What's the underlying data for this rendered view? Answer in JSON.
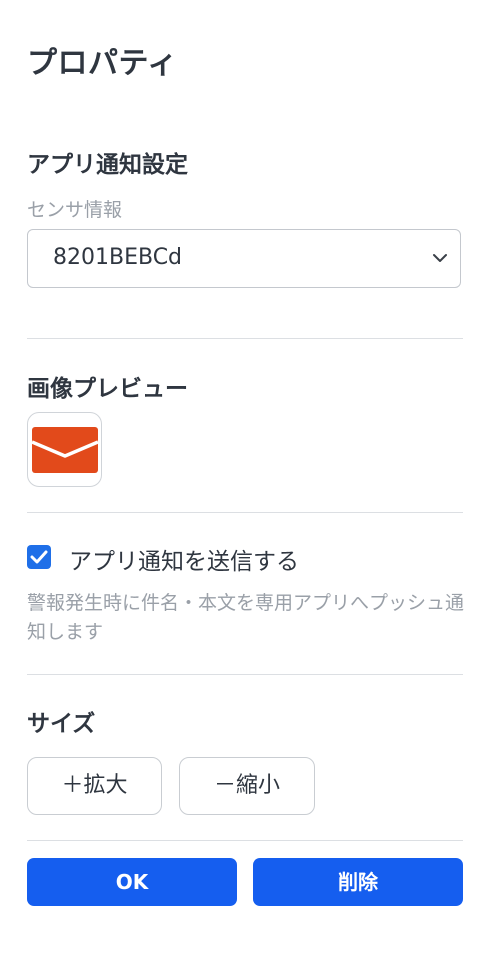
{
  "panel": {
    "title": "プロパティ"
  },
  "notification": {
    "heading": "アプリ通知設定",
    "sensor_label": "センサ情報",
    "sensor_value": "8201BEBCd"
  },
  "preview": {
    "heading": "画像プレビュー",
    "icon": "mail-envelope-icon",
    "icon_color": "#e24a1b"
  },
  "send": {
    "checked": true,
    "label": "アプリ通知を送信する",
    "help_text": "警報発生時に件名・本文を専用アプリへプッシュ通知します"
  },
  "size": {
    "heading": "サイズ",
    "enlarge_label": "＋拡大",
    "shrink_label": "－縮小"
  },
  "actions": {
    "ok_label": "OK",
    "delete_label": "削除"
  },
  "colors": {
    "primary": "#155eef",
    "checkbox": "#1f6fe8"
  }
}
